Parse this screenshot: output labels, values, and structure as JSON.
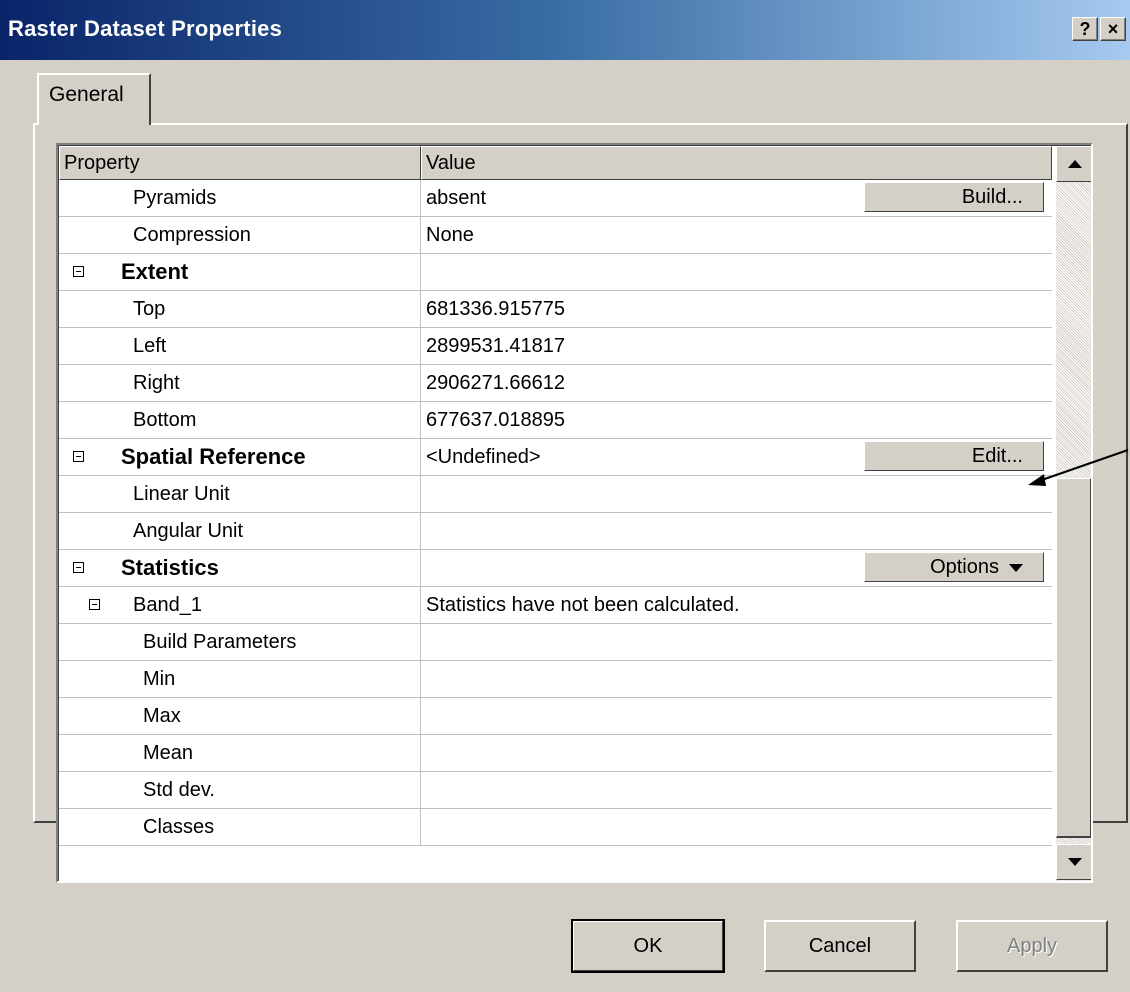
{
  "window": {
    "title": "Raster Dataset Properties",
    "help_label": "?",
    "close_label": "×"
  },
  "tabs": [
    {
      "label": "General"
    }
  ],
  "grid": {
    "headers": {
      "property": "Property",
      "value": "Value"
    },
    "rows": [
      {
        "label": "Pyramids",
        "value": "absent",
        "button": "Build..."
      },
      {
        "label": "Compression",
        "value": "None"
      },
      {
        "label": "Extent",
        "value": "",
        "group": true
      },
      {
        "label": "Top",
        "value": "681336.915775"
      },
      {
        "label": "Left",
        "value": "2899531.41817"
      },
      {
        "label": "Right",
        "value": "2906271.66612"
      },
      {
        "label": "Bottom",
        "value": "677637.018895"
      },
      {
        "label": "Spatial Reference",
        "value": "<Undefined>",
        "group": true,
        "button": "Edit..."
      },
      {
        "label": "Linear Unit",
        "value": ""
      },
      {
        "label": "Angular Unit",
        "value": ""
      },
      {
        "label": "Statistics",
        "value": "",
        "group": true,
        "button": "Options"
      },
      {
        "label": "Band_1",
        "value": "Statistics have not been calculated."
      },
      {
        "label": "Build Parameters",
        "value": ""
      },
      {
        "label": "Min",
        "value": ""
      },
      {
        "label": "Max",
        "value": ""
      },
      {
        "label": "Mean",
        "value": ""
      },
      {
        "label": "Std dev.",
        "value": ""
      },
      {
        "label": "Classes",
        "value": ""
      }
    ]
  },
  "buttons": {
    "ok": "OK",
    "cancel": "Cancel",
    "apply": "Apply"
  },
  "colors": {
    "title_start": "#0a246a",
    "title_end": "#a6caf0",
    "face": "#d4d0c8"
  }
}
